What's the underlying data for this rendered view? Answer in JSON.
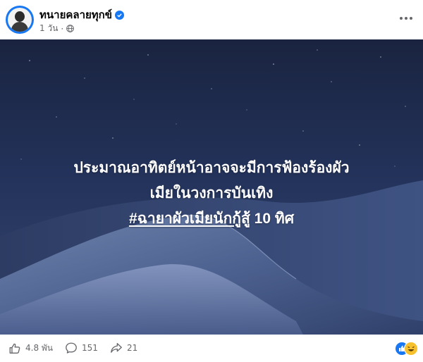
{
  "post": {
    "author": "ทนายคลายทุกข์",
    "time": "1 วัน",
    "overlay_lines": [
      "ประมาณอาทิตย์หน้าอาจจะมีการฟ้องร้องผัว",
      "เมียในวงการบันเทิง"
    ],
    "hashtag": "#ฉายาผัวเมียนักกู้",
    "hashtag_suffix": "สู้ 10 ทิศ"
  },
  "stats": {
    "likes": "4.8 พัน",
    "comments": "151",
    "shares": "21"
  },
  "colors": {
    "verified": "#1877f2",
    "meta_text": "#65676b",
    "image_sky": "#1b2745"
  },
  "icons": {
    "verified": "verified-badge-icon",
    "privacy": "globe-icon",
    "more": "more-options-icon",
    "like": "thumbs-up-icon",
    "comment": "comment-icon",
    "share": "share-icon"
  }
}
